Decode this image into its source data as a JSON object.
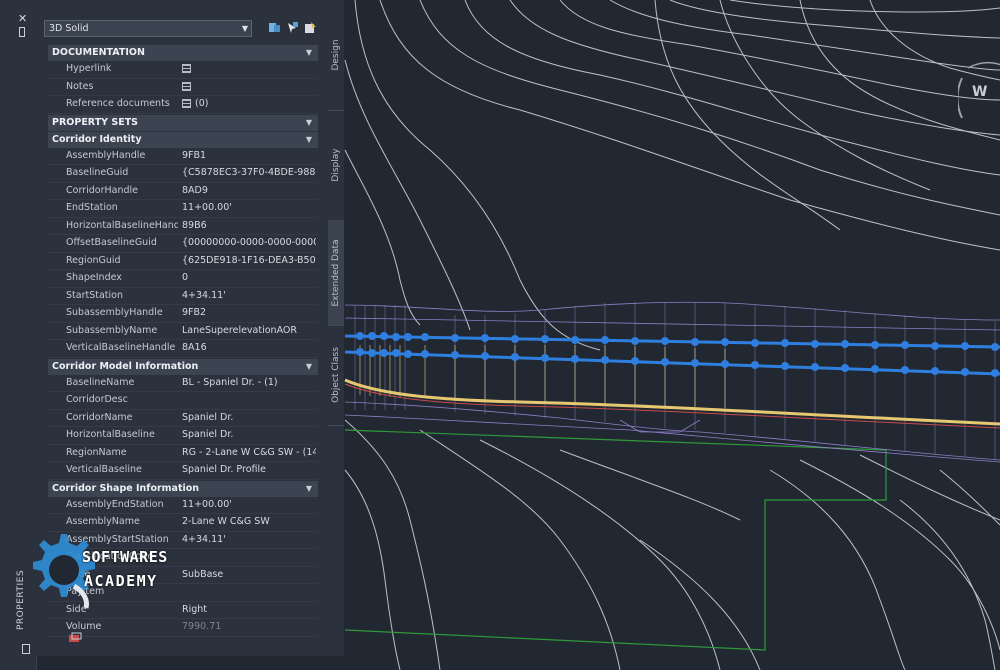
{
  "app": {
    "selector_value": "3D Solid",
    "compass_label": "W",
    "vertical_tabs": [
      "Design",
      "Display",
      "Extended Data",
      "Object Class"
    ],
    "left_strip_label": "PROPERTIES"
  },
  "documentation": {
    "header": "DOCUMENTATION",
    "rows": [
      {
        "k": "Hyperlink",
        "v": ""
      },
      {
        "k": "Notes",
        "v": ""
      },
      {
        "k": "Reference documents",
        "v": "(0)"
      }
    ]
  },
  "property_sets_header": "PROPERTY SETS",
  "corridor_identity": {
    "header": "Corridor Identity",
    "rows": [
      {
        "k": "AssemblyHandle",
        "v": "9FB1"
      },
      {
        "k": "BaselineGuid",
        "v": "{C5878EC3-37F0-4BDE-9887-..."
      },
      {
        "k": "CorridorHandle",
        "v": "8AD9"
      },
      {
        "k": "EndStation",
        "v": "11+00.00'"
      },
      {
        "k": "HorizontalBaselineHandle",
        "v": "89B6"
      },
      {
        "k": "OffsetBaselineGuid",
        "v": "{00000000-0000-0000-0000-0..."
      },
      {
        "k": "RegionGuid",
        "v": "{625DE918-1F16-DEA3-B502-..."
      },
      {
        "k": "ShapeIndex",
        "v": "0"
      },
      {
        "k": "StartStation",
        "v": "4+34.11'"
      },
      {
        "k": "SubassemblyHandle",
        "v": "9FB2"
      },
      {
        "k": "SubassemblyName",
        "v": "LaneSuperelevationAOR"
      },
      {
        "k": "VerticalBaselineHandle",
        "v": "8A16"
      }
    ]
  },
  "corridor_model": {
    "header": "Corridor Model Information",
    "rows": [
      {
        "k": "BaselineName",
        "v": "BL - Spaniel Dr. - (1)"
      },
      {
        "k": "CorridorDesc",
        "v": ""
      },
      {
        "k": "CorridorName",
        "v": "Spaniel Dr."
      },
      {
        "k": "HorizontalBaseline",
        "v": "Spaniel Dr."
      },
      {
        "k": "RegionName",
        "v": "RG - 2-Lane W C&G SW - (14)"
      },
      {
        "k": "VerticalBaseline",
        "v": "Spaniel Dr. Profile"
      }
    ]
  },
  "corridor_shape": {
    "header": "Corridor Shape Information",
    "rows": [
      {
        "k": "AssemblyEndStation",
        "v": "11+00.00'"
      },
      {
        "k": "AssemblyName",
        "v": "2-Lane W C&G SW"
      },
      {
        "k": "AssemblyStartStation",
        "v": "4+34.11'"
      },
      {
        "k": "ClassificationCode",
        "v": ""
      },
      {
        "k": "Code",
        "v": "SubBase"
      },
      {
        "k": "Payitem",
        "v": ""
      },
      {
        "k": "Side",
        "v": "Right"
      },
      {
        "k": "Volume",
        "v": "7990.71"
      }
    ]
  },
  "watermark": {
    "line1": "SOFTWARES",
    "line2": "ACADEMY"
  },
  "colors": {
    "background": "#212832",
    "panel": "#2b323d",
    "section_header": "#3c4452",
    "contour": "#d8dce3",
    "corridor_blue": "#2f7fe0",
    "corridor_yellow": "#e6c870",
    "boundary_green": "#2f9a3a",
    "mesh_purple": "#9a88d6"
  }
}
